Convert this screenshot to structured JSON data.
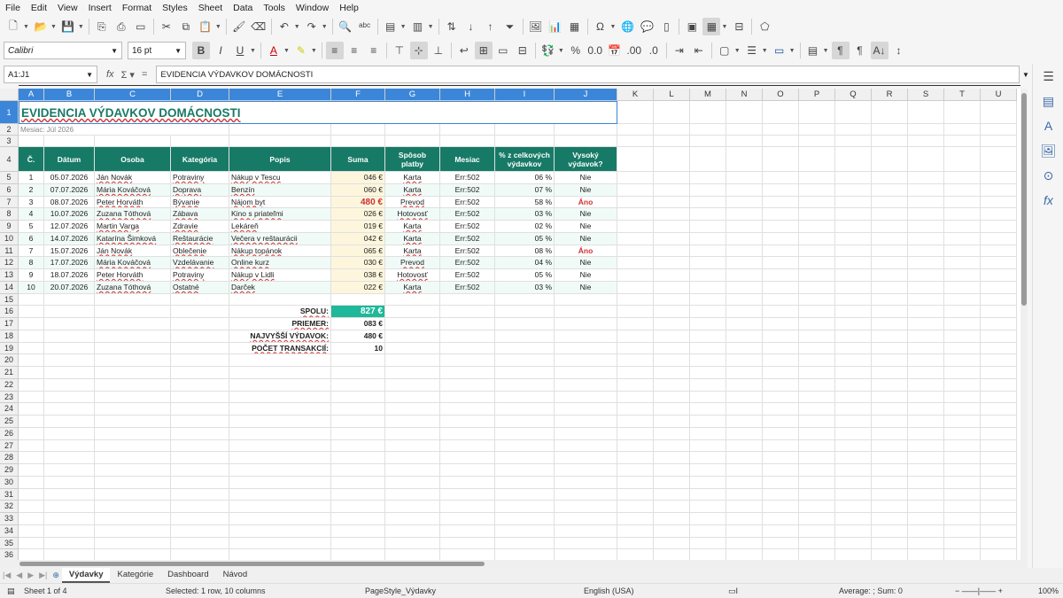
{
  "menu": [
    "File",
    "Edit",
    "View",
    "Insert",
    "Format",
    "Styles",
    "Sheet",
    "Data",
    "Tools",
    "Window",
    "Help"
  ],
  "toolbar": {
    "font_name": "Calibri",
    "font_size": "16 pt"
  },
  "formula_bar": {
    "cell_ref": "A1:J1",
    "content": "EVIDENCIA VÝDAVKOV DOMÁCNOSTI"
  },
  "columns": [
    "A",
    "B",
    "C",
    "D",
    "E",
    "F",
    "G",
    "H",
    "I",
    "J",
    "K",
    "L",
    "M",
    "N",
    "O",
    "P",
    "Q",
    "R",
    "S",
    "T",
    "U"
  ],
  "rows": [
    "1",
    "2",
    "3",
    "4",
    "5",
    "6",
    "7",
    "8",
    "9",
    "10",
    "11",
    "12",
    "13",
    "14",
    "15",
    "16",
    "17",
    "18",
    "19",
    "20",
    "21",
    "22",
    "23",
    "24",
    "25",
    "26",
    "27",
    "28",
    "29",
    "30",
    "31",
    "32",
    "33",
    "34",
    "35",
    "36"
  ],
  "sheet": {
    "title": "EVIDENCIA VÝDAVKOV DOMÁCNOSTI",
    "subtitle": "Mesiac: Júl 2026",
    "headers": [
      "Č.",
      "Dátum",
      "Osoba",
      "Kategória",
      "Popis",
      "Suma",
      "Spôsob platby",
      "Mesiac",
      "% z celkových výdavkov",
      "Vysoký výdavok?"
    ],
    "data": [
      [
        "1",
        "05.07.2026",
        "Ján Novák",
        "Potraviny",
        "Nákup v Tescu",
        "046 €",
        "Karta",
        "Err:502",
        "06 %",
        "Nie"
      ],
      [
        "2",
        "07.07.2026",
        "Mária Kováčová",
        "Doprava",
        "Benzín",
        "060 €",
        "Karta",
        "Err:502",
        "07 %",
        "Nie"
      ],
      [
        "3",
        "08.07.2026",
        "Peter Horváth",
        "Bývanie",
        "Nájom byt",
        "480 €",
        "Prevod",
        "Err:502",
        "58 %",
        "Áno"
      ],
      [
        "4",
        "10.07.2026",
        "Zuzana Tóthová",
        "Zábava",
        "Kino s priateľmi",
        "026 €",
        "Hotovosť",
        "Err:502",
        "03 %",
        "Nie"
      ],
      [
        "5",
        "12.07.2026",
        "Martin Varga",
        "Zdravie",
        "Lekáreň",
        "019 €",
        "Karta",
        "Err:502",
        "02 %",
        "Nie"
      ],
      [
        "6",
        "14.07.2026",
        "Katarína Šimková",
        "Reštaurácie",
        "Večera v reštaurácii",
        "042 €",
        "Karta",
        "Err:502",
        "05 %",
        "Nie"
      ],
      [
        "7",
        "15.07.2026",
        "Ján Novák",
        "Oblečenie",
        "Nákup topánok",
        "065 €",
        "Karta",
        "Err:502",
        "08 %",
        "Áno"
      ],
      [
        "8",
        "17.07.2026",
        "Mária Kováčová",
        "Vzdelávanie",
        "Online kurz",
        "030 €",
        "Prevod",
        "Err:502",
        "04 %",
        "Nie"
      ],
      [
        "9",
        "18.07.2026",
        "Peter Horváth",
        "Potraviny",
        "Nákup v Lidli",
        "038 €",
        "Hotovosť",
        "Err:502",
        "05 %",
        "Nie"
      ],
      [
        "10",
        "20.07.2026",
        "Zuzana Tóthová",
        "Ostatné",
        "Darček",
        "022 €",
        "Karta",
        "Err:502",
        "03 %",
        "Nie"
      ]
    ],
    "summary": [
      {
        "label": "SPOLU:",
        "value": "827 €"
      },
      {
        "label": "PRIEMER:",
        "value": "083 €"
      },
      {
        "label": "NAJVYŠŠÍ VÝDAVOK:",
        "value": "480 €"
      },
      {
        "label": "POČET TRANSAKCIÍ:",
        "value": "10"
      }
    ]
  },
  "tabs": [
    "Výdavky",
    "Kategórie",
    "Dashboard",
    "Návod"
  ],
  "status": {
    "sheet": "Sheet 1 of 4",
    "selection": "Selected: 1 row, 10 columns",
    "page_style": "PageStyle_Výdavky",
    "language": "English (USA)",
    "stats": "Average: ; Sum: 0",
    "zoom": "100%"
  }
}
